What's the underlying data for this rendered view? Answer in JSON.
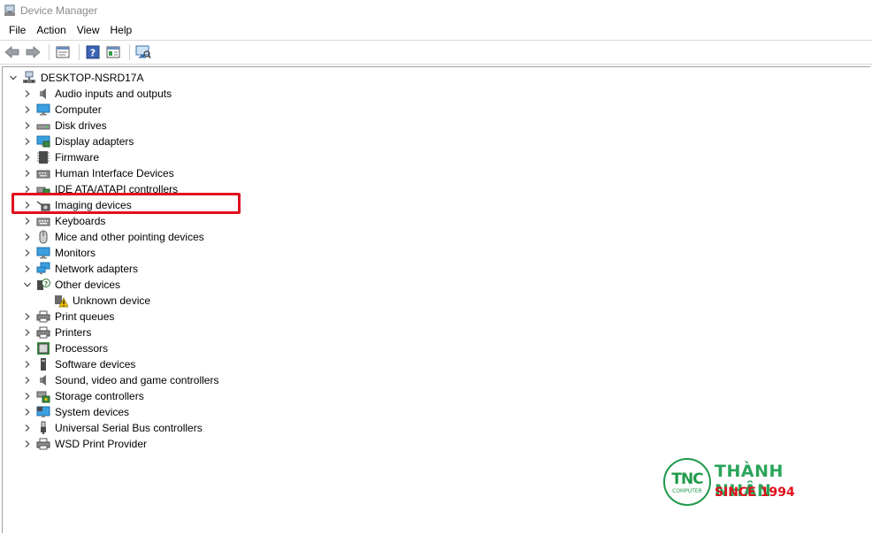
{
  "window": {
    "title": "Device Manager",
    "icon": "device-manager-icon"
  },
  "menu": [
    "File",
    "Action",
    "View",
    "Help"
  ],
  "toolbar": {
    "buttons": [
      "back-arrow-icon",
      "forward-arrow-icon",
      "properties-icon",
      "help-icon",
      "update-driver-icon",
      "scan-hardware-icon"
    ]
  },
  "tree": {
    "root": {
      "label": "DESKTOP-NSRD17A",
      "expanded": true,
      "icon": "computer-tree-icon"
    },
    "items": [
      {
        "label": "Audio inputs and outputs",
        "icon": "speaker-icon",
        "expanded": false
      },
      {
        "label": "Computer",
        "icon": "monitor-icon",
        "expanded": false
      },
      {
        "label": "Disk drives",
        "icon": "disk-drive-icon",
        "expanded": false
      },
      {
        "label": "Display adapters",
        "icon": "display-adapter-icon",
        "expanded": false
      },
      {
        "label": "Firmware",
        "icon": "firmware-chip-icon",
        "expanded": false
      },
      {
        "label": "Human Interface Devices",
        "icon": "keyboard-hid-icon",
        "expanded": false
      },
      {
        "label": "IDE ATA/ATAPI controllers",
        "icon": "ide-controller-icon",
        "expanded": false
      },
      {
        "label": "Imaging devices",
        "icon": "camera-icon",
        "expanded": false,
        "highlighted": true
      },
      {
        "label": "Keyboards",
        "icon": "keyboard-icon",
        "expanded": false
      },
      {
        "label": "Mice and other pointing devices",
        "icon": "mouse-icon",
        "expanded": false
      },
      {
        "label": "Monitors",
        "icon": "monitor-icon",
        "expanded": false
      },
      {
        "label": "Network adapters",
        "icon": "network-icon",
        "expanded": false
      },
      {
        "label": "Other devices",
        "icon": "unknown-device-icon",
        "expanded": true
      },
      {
        "label": "Unknown device",
        "icon": "warning-device-icon",
        "child": true
      },
      {
        "label": "Print queues",
        "icon": "printer-icon",
        "expanded": false
      },
      {
        "label": "Printers",
        "icon": "printer-icon",
        "expanded": false
      },
      {
        "label": "Processors",
        "icon": "processor-icon",
        "expanded": false
      },
      {
        "label": "Software devices",
        "icon": "software-device-icon",
        "expanded": false
      },
      {
        "label": "Sound, video and game controllers",
        "icon": "speaker-icon",
        "expanded": false
      },
      {
        "label": "Storage controllers",
        "icon": "storage-controller-icon",
        "expanded": false
      },
      {
        "label": "System devices",
        "icon": "system-device-icon",
        "expanded": false
      },
      {
        "label": "Universal Serial Bus controllers",
        "icon": "usb-icon",
        "expanded": false
      },
      {
        "label": "WSD Print Provider",
        "icon": "printer-icon",
        "expanded": false
      }
    ]
  },
  "watermark": {
    "logo_text": "TNC",
    "logo_sub": "COMPUTER",
    "brand": "THÀNH NHÂN",
    "since": "SINCE 1994"
  },
  "colors": {
    "highlight": "#e0101d",
    "brand_green": "#2aa55a",
    "brand_red": "#e0101d"
  }
}
